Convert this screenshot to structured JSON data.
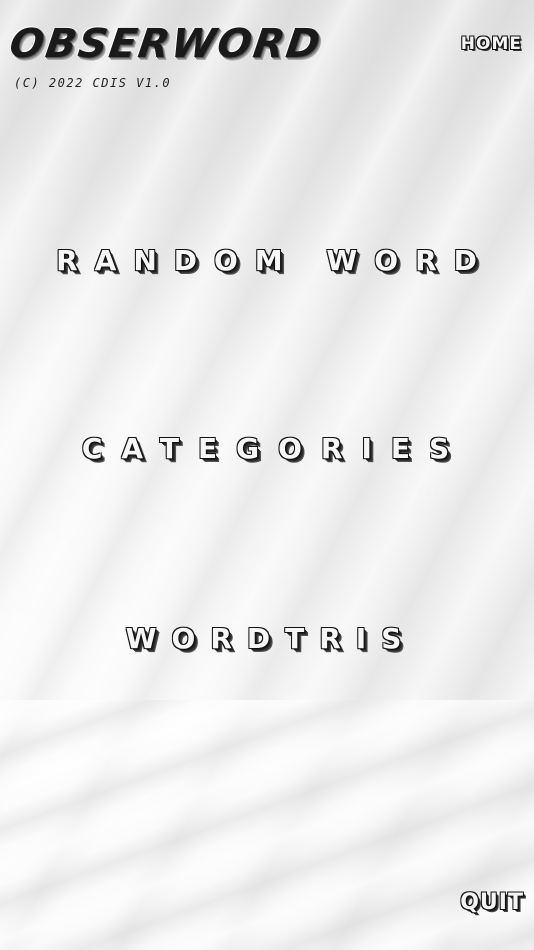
{
  "header": {
    "logo": "OBSERWORD",
    "copyright": "(C) 2022 CDIS V1.0",
    "home_label": "HOME"
  },
  "menu": {
    "items": [
      {
        "label": "RANDOM WORD"
      },
      {
        "label": "CATEGORIES"
      },
      {
        "label": "WORDTRIS"
      }
    ]
  },
  "footer": {
    "quit_label": "QUIT"
  }
}
